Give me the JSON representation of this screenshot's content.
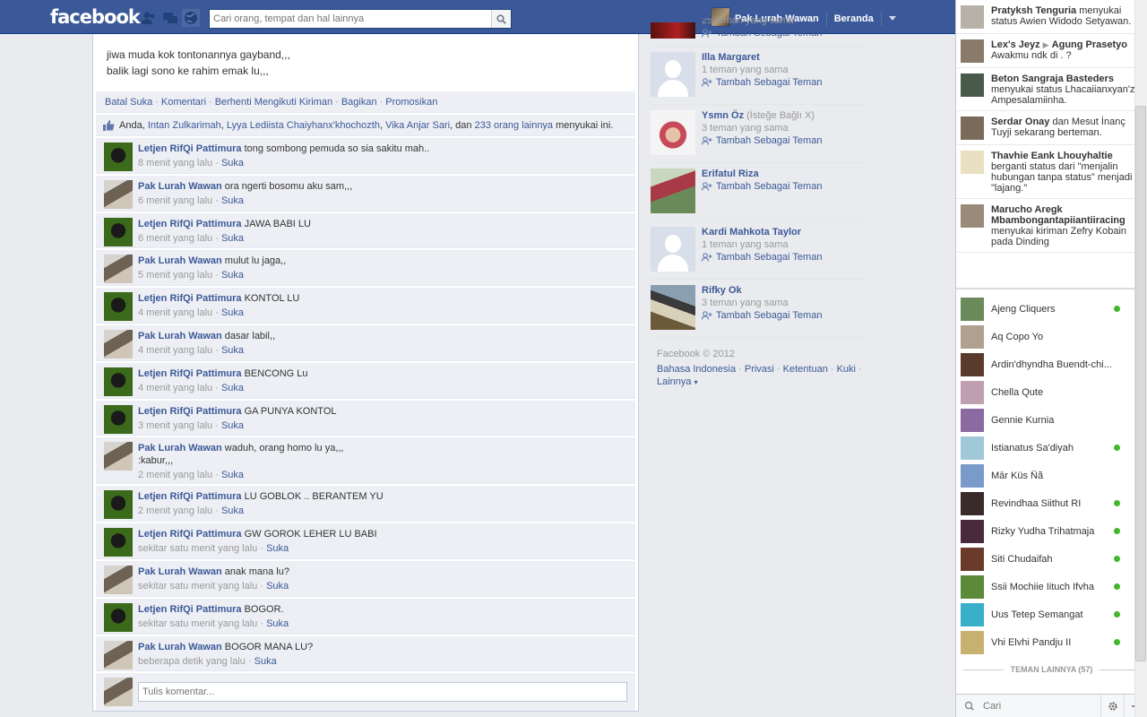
{
  "header": {
    "logo": "facebook",
    "search_placeholder": "Cari orang, tempat dan hal lainnya",
    "user_name": "Pak Lurah Wawan",
    "home_label": "Beranda"
  },
  "post": {
    "text_line1": "jiwa muda kok tontonannya gayband,,,",
    "text_line2": "balik lagi sono ke rahim emak lu,,,",
    "actions": [
      "Batal Suka",
      "Komentari",
      "Berhenti Mengikuti Kiriman",
      "Bagikan",
      "Promosikan"
    ],
    "likes": {
      "you": "Anda",
      "names": [
        "Intan Zulkarimah",
        "Lyya Lediista Chaiyhanx'khochozth",
        "Vika Anjar Sari"
      ],
      "conj": "dan",
      "others": "233 orang lainnya",
      "suffix": "menyukai ini."
    },
    "like_label": "Suka",
    "comments": [
      {
        "name": "Letjen RifQi Pattimura",
        "text": "tong sombong pemuda so sia sakitu mah..",
        "time": "8 menit yang lalu"
      },
      {
        "name": "Pak Lurah Wawan",
        "text": "ora ngerti bosomu aku sam,,,",
        "time": "6 menit yang lalu"
      },
      {
        "name": "Letjen RifQi Pattimura",
        "text": "JAWA BABI LU",
        "time": "6 menit yang lalu"
      },
      {
        "name": "Pak Lurah Wawan",
        "text": "mulut lu jaga,,",
        "time": "5 menit yang lalu"
      },
      {
        "name": "Letjen RifQi Pattimura",
        "text": "KONTOL LU",
        "time": "4 menit yang lalu"
      },
      {
        "name": "Pak Lurah Wawan",
        "text": "dasar labil,,",
        "time": "4 menit yang lalu"
      },
      {
        "name": "Letjen RifQi Pattimura",
        "text": "BENCONG Lu",
        "time": "4 menit yang lalu"
      },
      {
        "name": "Letjen RifQi Pattimura",
        "text": "GA PUNYA KONTOL",
        "time": "3 menit yang lalu"
      },
      {
        "name": "Pak Lurah Wawan",
        "text": "waduh, orang homo lu ya,,,",
        "text2": ":kabur,,,",
        "time": "2 menit yang lalu"
      },
      {
        "name": "Letjen RifQi Pattimura",
        "text": "LU GOBLOK .. BERANTEM YU",
        "time": "2 menit yang lalu"
      },
      {
        "name": "Letjen RifQi Pattimura",
        "text": "GW GOROK LEHER LU BABI",
        "time": "sekitar satu menit yang lalu"
      },
      {
        "name": "Pak Lurah Wawan",
        "text": "anak mana lu?",
        "time": "sekitar satu menit yang lalu"
      },
      {
        "name": "Letjen RifQi Pattimura",
        "text": "BOGOR.",
        "time": "sekitar satu menit yang lalu"
      },
      {
        "name": "Pak Lurah Wawan",
        "text": "BOGOR MANA LU?",
        "time": "beberapa detik yang lalu"
      }
    ],
    "comment_placeholder": "Tulis komentar..."
  },
  "suggestions": {
    "partial_top": {
      "sub": "25 teman yang sama",
      "add": "Tambah Sebagai Teman"
    },
    "items": [
      {
        "name": "Illa Margaret",
        "extra": "",
        "sub": "1 teman yang sama",
        "add": "Tambah Sebagai Teman"
      },
      {
        "name": "Ysmn Öz",
        "extra": "(İsteğe Bağlı X)",
        "sub": "3 teman yang sama",
        "add": "Tambah Sebagai Teman"
      },
      {
        "name": "Erifatul Riza",
        "extra": "",
        "sub": "",
        "add": "Tambah Sebagai Teman"
      },
      {
        "name": "Kardi Mahkota Taylor",
        "extra": "",
        "sub": "1 teman yang sama",
        "add": "Tambah Sebagai Teman"
      },
      {
        "name": "Rifky Ok",
        "extra": "",
        "sub": "3 teman yang sama",
        "add": "Tambah Sebagai Teman"
      }
    ]
  },
  "footer": {
    "copyright": "Facebook © 2012",
    "links": [
      "Bahasa Indonesia",
      "Privasi",
      "Ketentuan",
      "Kuki"
    ],
    "more": "Lainnya"
  },
  "ticker": [
    {
      "name": "Pratyksh Tenguria",
      "text": "menyukai status Awien Widodo Setyawan."
    },
    {
      "name": "Lex's Jeyz",
      "name2": "Agung Prasetyo",
      "text": "Awakmu ndk di . ?"
    },
    {
      "name": "Beton Sangraja Basteders",
      "text": "menyukai status Lhacaiianxyan'z Ampesalamiinha."
    },
    {
      "name": "Serdar Onay",
      "text": "dan Mesut İnanç Tuyji sekarang berteman."
    },
    {
      "name": "Thavhie Eank Lhouyhaltie",
      "text": "berganti status dari \"menjalin hubungan tanpa status\" menjadi \"lajang.\""
    },
    {
      "name": "Marucho Aregk Mbambongantapiiantiiracing",
      "text": "menyukai kiriman Zefry Kobain pada Dinding"
    }
  ],
  "chat": {
    "friends": [
      {
        "name": "Ajeng Cliquers",
        "online": true
      },
      {
        "name": "Aq Copo Yo",
        "online": false
      },
      {
        "name": "Ardin'dhyndha Buendt-chi...",
        "online": false
      },
      {
        "name": "Chella Qute",
        "online": false
      },
      {
        "name": "Gennie Kurnia",
        "online": false
      },
      {
        "name": "Istianatus Sa'diyah",
        "online": true
      },
      {
        "name": "Mār Küs Ñã",
        "online": false
      },
      {
        "name": "Revindhaa Siithut RI",
        "online": true
      },
      {
        "name": "Rizky Yudha Trihatmaja",
        "online": true
      },
      {
        "name": "Siti Chudaifah",
        "online": true
      },
      {
        "name": "Ssii Mochiie Iituch Ifvha",
        "online": true
      },
      {
        "name": "Uus Tetep Semangat",
        "online": true
      },
      {
        "name": "Vhi Elvhi Pandju II",
        "online": true
      }
    ],
    "more_label": "TEMAN LAINNYA (57)",
    "search_placeholder": "Cari"
  }
}
